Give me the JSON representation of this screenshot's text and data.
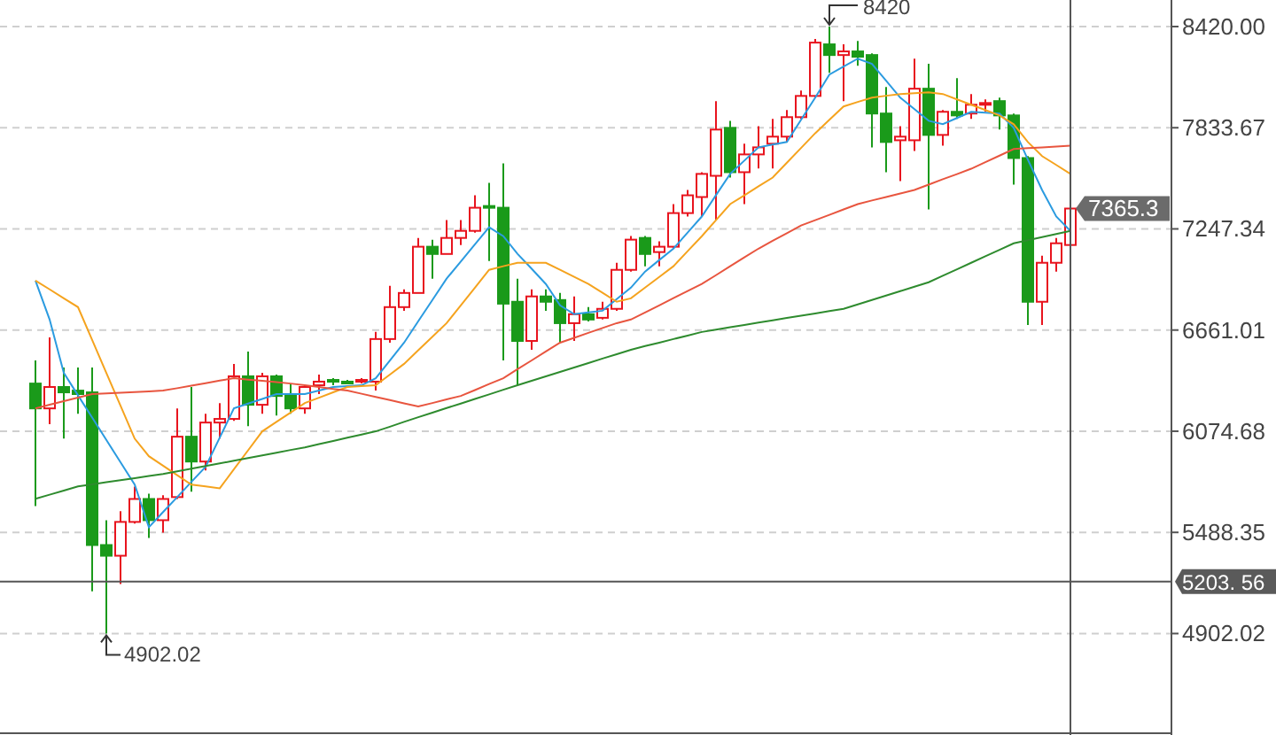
{
  "chart": {
    "chart_data": {
      "type": "candlestick",
      "grid": true,
      "ylim": [
        4314,
        8574
      ],
      "ref_lines": [
        {
          "axis": "y",
          "value": 5203.56
        }
      ],
      "series": [
        {
          "type": "line",
          "color": "#2b9be0",
          "values": [
            6948,
            6722,
            6413,
            6283,
            6154,
            6024,
            5895,
            5765,
            5518,
            5606,
            5693,
            5781,
            5868,
            6038,
            6207,
            6235,
            6262,
            6290,
            6290,
            6290,
            6311,
            6331,
            6336,
            6341,
            6382,
            6485,
            6588,
            6712,
            6835,
            6959,
            7058,
            7158,
            7257,
            7205,
            7103,
            7016,
            6928,
            6804,
            6753,
            6763,
            6773,
            6840,
            6907,
            7000,
            7067,
            7133,
            7226,
            7319,
            7443,
            7566,
            7643,
            7720,
            7736,
            7751,
            7880,
            8008,
            8142,
            8188,
            8234,
            8204,
            8106,
            8008,
            7941,
            7874,
            7854,
            7890,
            7926,
            7921,
            7916,
            7833,
            7648,
            7473,
            7319,
            7236
          ]
        },
        {
          "type": "line",
          "color": "#f5a31e",
          "values": [
            6948,
            6897,
            6845,
            6794,
            6604,
            6413,
            6223,
            6032,
            5930,
            5875,
            5820,
            5765,
            5755,
            5744,
            5854,
            5964,
            6074,
            6129,
            6183,
            6238,
            6269,
            6300,
            6331,
            6336,
            6341,
            6403,
            6465,
            6544,
            6622,
            6701,
            6804,
            6907,
            7010,
            7031,
            7051,
            7051,
            7051,
            7010,
            6969,
            6928,
            6877,
            6825,
            6845,
            6907,
            6969,
            7031,
            7118,
            7205,
            7298,
            7391,
            7442,
            7494,
            7545,
            7631,
            7716,
            7802,
            7880,
            7957,
            7983,
            8008,
            8019,
            8029,
            8034,
            8039,
            8029,
            7998,
            7967,
            7936,
            7905,
            7854,
            7751,
            7669,
            7618,
            7566
          ]
        },
        {
          "type": "line",
          "color": "#e8553f",
          "values": [
            6207,
            6228,
            6249,
            6269,
            6290,
            6294,
            6298,
            6302,
            6306,
            6310,
            6324,
            6339,
            6353,
            6368,
            6382,
            6374,
            6367,
            6359,
            6351,
            6341,
            6331,
            6320,
            6310,
            6292,
            6273,
            6255,
            6236,
            6218,
            6238,
            6259,
            6279,
            6313,
            6348,
            6382,
            6434,
            6485,
            6537,
            6588,
            6616,
            6645,
            6673,
            6701,
            6722,
            6763,
            6804,
            6846,
            6887,
            6928,
            6979,
            7031,
            7082,
            7133,
            7178,
            7222,
            7267,
            7298,
            7329,
            7360,
            7391,
            7412,
            7432,
            7453,
            7473,
            7504,
            7535,
            7565,
            7596,
            7634,
            7672,
            7710,
            7715,
            7720,
            7725,
            7730
          ]
        },
        {
          "type": "line",
          "color": "#2e8b2e",
          "values": [
            5683,
            5707,
            5731,
            5755,
            5767,
            5779,
            5791,
            5803,
            5815,
            5827,
            5842,
            5858,
            5873,
            5888,
            5904,
            5919,
            5935,
            5950,
            5966,
            5981,
            6000,
            6018,
            6037,
            6055,
            6074,
            6101,
            6129,
            6156,
            6182,
            6209,
            6235,
            6262,
            6288,
            6315,
            6341,
            6367,
            6393,
            6418,
            6444,
            6470,
            6496,
            6521,
            6547,
            6568,
            6588,
            6609,
            6629,
            6650,
            6663,
            6677,
            6690,
            6704,
            6717,
            6731,
            6744,
            6757,
            6771,
            6784,
            6810,
            6835,
            6861,
            6887,
            6912,
            6938,
            6976,
            7013,
            7051,
            7089,
            7126,
            7164,
            7182,
            7200,
            7218,
            7236
          ]
        }
      ],
      "categories": [
        null,
        null,
        null,
        null,
        null,
        null,
        null,
        null,
        null,
        null,
        null,
        null,
        null,
        null,
        null,
        null,
        null,
        null,
        null,
        null,
        null,
        null,
        null,
        null,
        null,
        null,
        null,
        null,
        null,
        null,
        null,
        null,
        null,
        null,
        null,
        null,
        null,
        null,
        null,
        null,
        null,
        null,
        null,
        null,
        null,
        null,
        null,
        null,
        null,
        null,
        null,
        null,
        null,
        null,
        null,
        null,
        null,
        null,
        null,
        null,
        null,
        null,
        null,
        null,
        null,
        null,
        null,
        null,
        null,
        null,
        null,
        null,
        null,
        null
      ],
      "yticks": [
        {
          "value": 8420,
          "label": "8420.00"
        },
        {
          "value": 7833.67,
          "label": "7833.67"
        },
        {
          "value": 7247.34,
          "label": "7247.34"
        },
        {
          "value": 6661.01,
          "label": "6661.01"
        },
        {
          "value": 6074.68,
          "label": "6074.68"
        },
        {
          "value": 5488.35,
          "label": "5488.35"
        },
        {
          "value": 4902.02,
          "label": "4902.02"
        }
      ],
      "ohlc": [
        [
          6351,
          6485,
          5641,
          6207
        ],
        [
          6207,
          6619,
          6115,
          6331
        ],
        [
          6331,
          6444,
          6032,
          6300
        ],
        [
          6310,
          6444,
          6176,
          6290
        ],
        [
          6300,
          6444,
          5147,
          5415
        ],
        [
          5415,
          5559,
          4902.02,
          5353
        ],
        [
          5353,
          5611,
          5189,
          5549
        ],
        [
          5549,
          5754,
          5539,
          5682
        ],
        [
          5682,
          5713,
          5456,
          5559
        ],
        [
          5559,
          5703,
          5487,
          5682
        ],
        [
          5693,
          6207,
          5682,
          6043
        ],
        [
          6043,
          6331,
          5724,
          5899
        ],
        [
          5899,
          6176,
          5847,
          6125
        ],
        [
          6125,
          6238,
          6032,
          6146
        ],
        [
          6146,
          6465,
          6135,
          6393
        ],
        [
          6393,
          6537,
          6104,
          6228
        ],
        [
          6228,
          6413,
          6176,
          6393
        ],
        [
          6393,
          6403,
          6166,
          6279
        ],
        [
          6290,
          6351,
          6176,
          6207
        ],
        [
          6207,
          6341,
          6176,
          6331
        ],
        [
          6341,
          6403,
          6290,
          6362
        ],
        [
          6372,
          6382,
          6341,
          6362
        ],
        [
          6362,
          6372,
          6351,
          6358
        ],
        [
          6362,
          6382,
          6351,
          6372
        ],
        [
          6362,
          6650,
          6310,
          6609
        ],
        [
          6609,
          6917,
          6588,
          6794
        ],
        [
          6794,
          6897,
          6773,
          6876
        ],
        [
          6876,
          7195,
          6876,
          7144
        ],
        [
          7144,
          7185,
          6958,
          7102
        ],
        [
          7102,
          7298,
          7102,
          7195
        ],
        [
          7195,
          7298,
          7154,
          7236
        ],
        [
          7236,
          7442,
          7226,
          7370
        ],
        [
          7380,
          7514,
          7061,
          7370
        ],
        [
          7370,
          7627,
          6485,
          6814
        ],
        [
          6825,
          6958,
          6341,
          6598
        ],
        [
          6598,
          6897,
          6547,
          6856
        ],
        [
          6856,
          6897,
          6773,
          6825
        ],
        [
          6835,
          6876,
          6588,
          6701
        ],
        [
          6701,
          6856,
          6598,
          6753
        ],
        [
          6753,
          6794,
          6711,
          6722
        ],
        [
          6732,
          6825,
          6722,
          6784
        ],
        [
          6784,
          7051,
          6773,
          7010
        ],
        [
          7010,
          7206,
          7000,
          7185
        ],
        [
          7195,
          7206,
          7031,
          7102
        ],
        [
          7113,
          7175,
          7031,
          7144
        ],
        [
          7144,
          7391,
          7133,
          7339
        ],
        [
          7339,
          7473,
          7319,
          7442
        ],
        [
          7432,
          7576,
          7319,
          7566
        ],
        [
          7555,
          7988,
          7298,
          7823
        ],
        [
          7833,
          7874,
          7545,
          7576
        ],
        [
          7576,
          7741,
          7391,
          7679
        ],
        [
          7679,
          7843,
          7597,
          7720
        ],
        [
          7741,
          7885,
          7597,
          7782
        ],
        [
          7782,
          7936,
          7751,
          7895
        ],
        [
          7895,
          8049,
          7885,
          8018
        ],
        [
          8018,
          8348,
          8008,
          8327
        ],
        [
          8317,
          8420,
          8152,
          8255
        ],
        [
          8255,
          8317,
          7988,
          8276
        ],
        [
          8276,
          8337,
          8193,
          8245
        ],
        [
          8255,
          8265,
          7720,
          7916
        ],
        [
          7916,
          8070,
          7576,
          7751
        ],
        [
          7761,
          7843,
          7524,
          7782
        ],
        [
          7761,
          8234,
          7699,
          8060
        ],
        [
          8060,
          8204,
          7360,
          7792
        ],
        [
          7792,
          7936,
          7730,
          7926
        ],
        [
          7926,
          8121,
          7885,
          7905
        ],
        [
          7916,
          8029,
          7885,
          7967
        ],
        [
          7967,
          7998,
          7926,
          7977
        ],
        [
          7988,
          8008,
          7823,
          7905
        ],
        [
          7905,
          7916,
          7504,
          7658
        ],
        [
          7658,
          7669,
          6691,
          6825
        ],
        [
          6825,
          7092,
          6691,
          7051
        ],
        [
          7051,
          7195,
          7000,
          7164
        ],
        [
          7154,
          7370,
          7144,
          7365.3
        ]
      ]
    },
    "markers": [
      {
        "kind": "high",
        "label": "8420"
      },
      {
        "kind": "low",
        "label": "4902.02"
      },
      {
        "kind": "last",
        "label": "7365.3"
      },
      {
        "kind": "crosshair",
        "label": "5203. 56"
      }
    ]
  }
}
